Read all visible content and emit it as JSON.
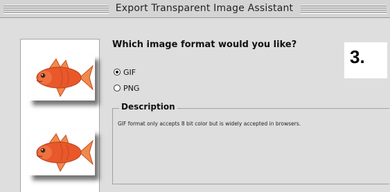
{
  "window": {
    "title": "Export Transparent Image Assistant"
  },
  "question": "Which image format would you like?",
  "step": "3.",
  "formats": [
    {
      "label": "GIF",
      "selected": true
    },
    {
      "label": "PNG",
      "selected": false
    }
  ],
  "description": {
    "legend": "Description",
    "text": "GIF format only accepts 8 bit color but is widely accepted in browsers."
  },
  "thumbnails": [
    {
      "icon": "goldfish-icon"
    },
    {
      "icon": "goldfish-icon"
    }
  ],
  "colors": {
    "background": "#dedede",
    "fish": "#e8582a",
    "fish_fin": "#f08a4b"
  }
}
